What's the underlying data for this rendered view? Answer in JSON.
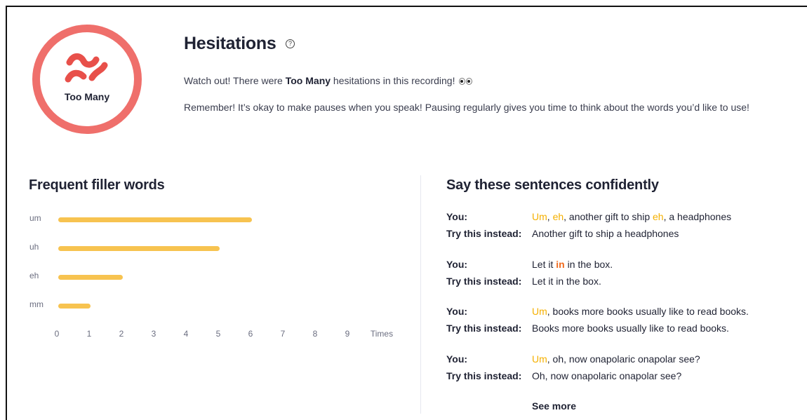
{
  "header": {
    "badge_label": "Too Many",
    "title": "Hesitations",
    "help_icon": "question-circle-icon",
    "warning_prefix": "Watch out! There were ",
    "warning_bold": "Too Many",
    "warning_suffix": " hesitations in this recording!",
    "warning_emoji": "eyes-emoji",
    "tip": "Remember! It’s okay to make pauses when you speak! Pausing regularly gives you time to think about the words you’d like to use!",
    "colors": {
      "ring": "#ef6f6b",
      "wave": "#e8504a"
    }
  },
  "filler": {
    "heading": "Frequent filler words",
    "x_axis_unit": "Times"
  },
  "chart_data": {
    "type": "bar",
    "orientation": "horizontal",
    "categories": [
      "um",
      "uh",
      "eh",
      "mm"
    ],
    "values": [
      6,
      5,
      2,
      1
    ],
    "xlabel": "Times",
    "xlim": [
      0,
      9
    ],
    "ticks": [
      "0",
      "1",
      "2",
      "3",
      "4",
      "5",
      "6",
      "7",
      "8",
      "9"
    ],
    "color": "#f7c350",
    "grid": false
  },
  "sentences": {
    "heading": "Say these sentences confidently",
    "you_label": "You:",
    "try_label": "Try this instead:",
    "items": [
      {
        "you_parts": [
          {
            "text": "Um",
            "hl": "y"
          },
          {
            "text": ", ",
            "hl": ""
          },
          {
            "text": "eh",
            "hl": "y"
          },
          {
            "text": ", another gift to ship ",
            "hl": ""
          },
          {
            "text": "eh",
            "hl": "y"
          },
          {
            "text": ", a headphones",
            "hl": ""
          }
        ],
        "try": "Another gift to ship a headphones"
      },
      {
        "you_parts": [
          {
            "text": "Let it ",
            "hl": ""
          },
          {
            "text": "in",
            "hl": "o"
          },
          {
            "text": " in the box.",
            "hl": ""
          }
        ],
        "try": "Let it in the box."
      },
      {
        "you_parts": [
          {
            "text": "Um",
            "hl": "y"
          },
          {
            "text": ", books more books usually like to read books.",
            "hl": ""
          }
        ],
        "try": "Books more books usually like to read books."
      },
      {
        "you_parts": [
          {
            "text": "Um",
            "hl": "y"
          },
          {
            "text": ", oh, now onapolaric onapolar see?",
            "hl": ""
          }
        ],
        "try": "Oh, now onapolaric onapolar see?"
      }
    ],
    "see_more": "See more"
  }
}
